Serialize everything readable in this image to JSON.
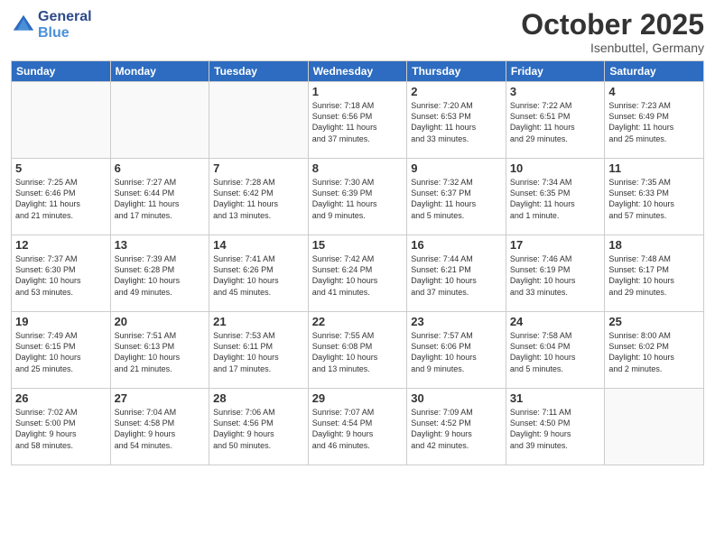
{
  "header": {
    "logo_line1": "General",
    "logo_line2": "Blue",
    "month": "October 2025",
    "location": "Isenbuttel, Germany"
  },
  "days_of_week": [
    "Sunday",
    "Monday",
    "Tuesday",
    "Wednesday",
    "Thursday",
    "Friday",
    "Saturday"
  ],
  "weeks": [
    [
      {
        "day": "",
        "text": ""
      },
      {
        "day": "",
        "text": ""
      },
      {
        "day": "",
        "text": ""
      },
      {
        "day": "1",
        "text": "Sunrise: 7:18 AM\nSunset: 6:56 PM\nDaylight: 11 hours\nand 37 minutes."
      },
      {
        "day": "2",
        "text": "Sunrise: 7:20 AM\nSunset: 6:53 PM\nDaylight: 11 hours\nand 33 minutes."
      },
      {
        "day": "3",
        "text": "Sunrise: 7:22 AM\nSunset: 6:51 PM\nDaylight: 11 hours\nand 29 minutes."
      },
      {
        "day": "4",
        "text": "Sunrise: 7:23 AM\nSunset: 6:49 PM\nDaylight: 11 hours\nand 25 minutes."
      }
    ],
    [
      {
        "day": "5",
        "text": "Sunrise: 7:25 AM\nSunset: 6:46 PM\nDaylight: 11 hours\nand 21 minutes."
      },
      {
        "day": "6",
        "text": "Sunrise: 7:27 AM\nSunset: 6:44 PM\nDaylight: 11 hours\nand 17 minutes."
      },
      {
        "day": "7",
        "text": "Sunrise: 7:28 AM\nSunset: 6:42 PM\nDaylight: 11 hours\nand 13 minutes."
      },
      {
        "day": "8",
        "text": "Sunrise: 7:30 AM\nSunset: 6:39 PM\nDaylight: 11 hours\nand 9 minutes."
      },
      {
        "day": "9",
        "text": "Sunrise: 7:32 AM\nSunset: 6:37 PM\nDaylight: 11 hours\nand 5 minutes."
      },
      {
        "day": "10",
        "text": "Sunrise: 7:34 AM\nSunset: 6:35 PM\nDaylight: 11 hours\nand 1 minute."
      },
      {
        "day": "11",
        "text": "Sunrise: 7:35 AM\nSunset: 6:33 PM\nDaylight: 10 hours\nand 57 minutes."
      }
    ],
    [
      {
        "day": "12",
        "text": "Sunrise: 7:37 AM\nSunset: 6:30 PM\nDaylight: 10 hours\nand 53 minutes."
      },
      {
        "day": "13",
        "text": "Sunrise: 7:39 AM\nSunset: 6:28 PM\nDaylight: 10 hours\nand 49 minutes."
      },
      {
        "day": "14",
        "text": "Sunrise: 7:41 AM\nSunset: 6:26 PM\nDaylight: 10 hours\nand 45 minutes."
      },
      {
        "day": "15",
        "text": "Sunrise: 7:42 AM\nSunset: 6:24 PM\nDaylight: 10 hours\nand 41 minutes."
      },
      {
        "day": "16",
        "text": "Sunrise: 7:44 AM\nSunset: 6:21 PM\nDaylight: 10 hours\nand 37 minutes."
      },
      {
        "day": "17",
        "text": "Sunrise: 7:46 AM\nSunset: 6:19 PM\nDaylight: 10 hours\nand 33 minutes."
      },
      {
        "day": "18",
        "text": "Sunrise: 7:48 AM\nSunset: 6:17 PM\nDaylight: 10 hours\nand 29 minutes."
      }
    ],
    [
      {
        "day": "19",
        "text": "Sunrise: 7:49 AM\nSunset: 6:15 PM\nDaylight: 10 hours\nand 25 minutes."
      },
      {
        "day": "20",
        "text": "Sunrise: 7:51 AM\nSunset: 6:13 PM\nDaylight: 10 hours\nand 21 minutes."
      },
      {
        "day": "21",
        "text": "Sunrise: 7:53 AM\nSunset: 6:11 PM\nDaylight: 10 hours\nand 17 minutes."
      },
      {
        "day": "22",
        "text": "Sunrise: 7:55 AM\nSunset: 6:08 PM\nDaylight: 10 hours\nand 13 minutes."
      },
      {
        "day": "23",
        "text": "Sunrise: 7:57 AM\nSunset: 6:06 PM\nDaylight: 10 hours\nand 9 minutes."
      },
      {
        "day": "24",
        "text": "Sunrise: 7:58 AM\nSunset: 6:04 PM\nDaylight: 10 hours\nand 5 minutes."
      },
      {
        "day": "25",
        "text": "Sunrise: 8:00 AM\nSunset: 6:02 PM\nDaylight: 10 hours\nand 2 minutes."
      }
    ],
    [
      {
        "day": "26",
        "text": "Sunrise: 7:02 AM\nSunset: 5:00 PM\nDaylight: 9 hours\nand 58 minutes."
      },
      {
        "day": "27",
        "text": "Sunrise: 7:04 AM\nSunset: 4:58 PM\nDaylight: 9 hours\nand 54 minutes."
      },
      {
        "day": "28",
        "text": "Sunrise: 7:06 AM\nSunset: 4:56 PM\nDaylight: 9 hours\nand 50 minutes."
      },
      {
        "day": "29",
        "text": "Sunrise: 7:07 AM\nSunset: 4:54 PM\nDaylight: 9 hours\nand 46 minutes."
      },
      {
        "day": "30",
        "text": "Sunrise: 7:09 AM\nSunset: 4:52 PM\nDaylight: 9 hours\nand 42 minutes."
      },
      {
        "day": "31",
        "text": "Sunrise: 7:11 AM\nSunset: 4:50 PM\nDaylight: 9 hours\nand 39 minutes."
      },
      {
        "day": "",
        "text": ""
      }
    ]
  ]
}
